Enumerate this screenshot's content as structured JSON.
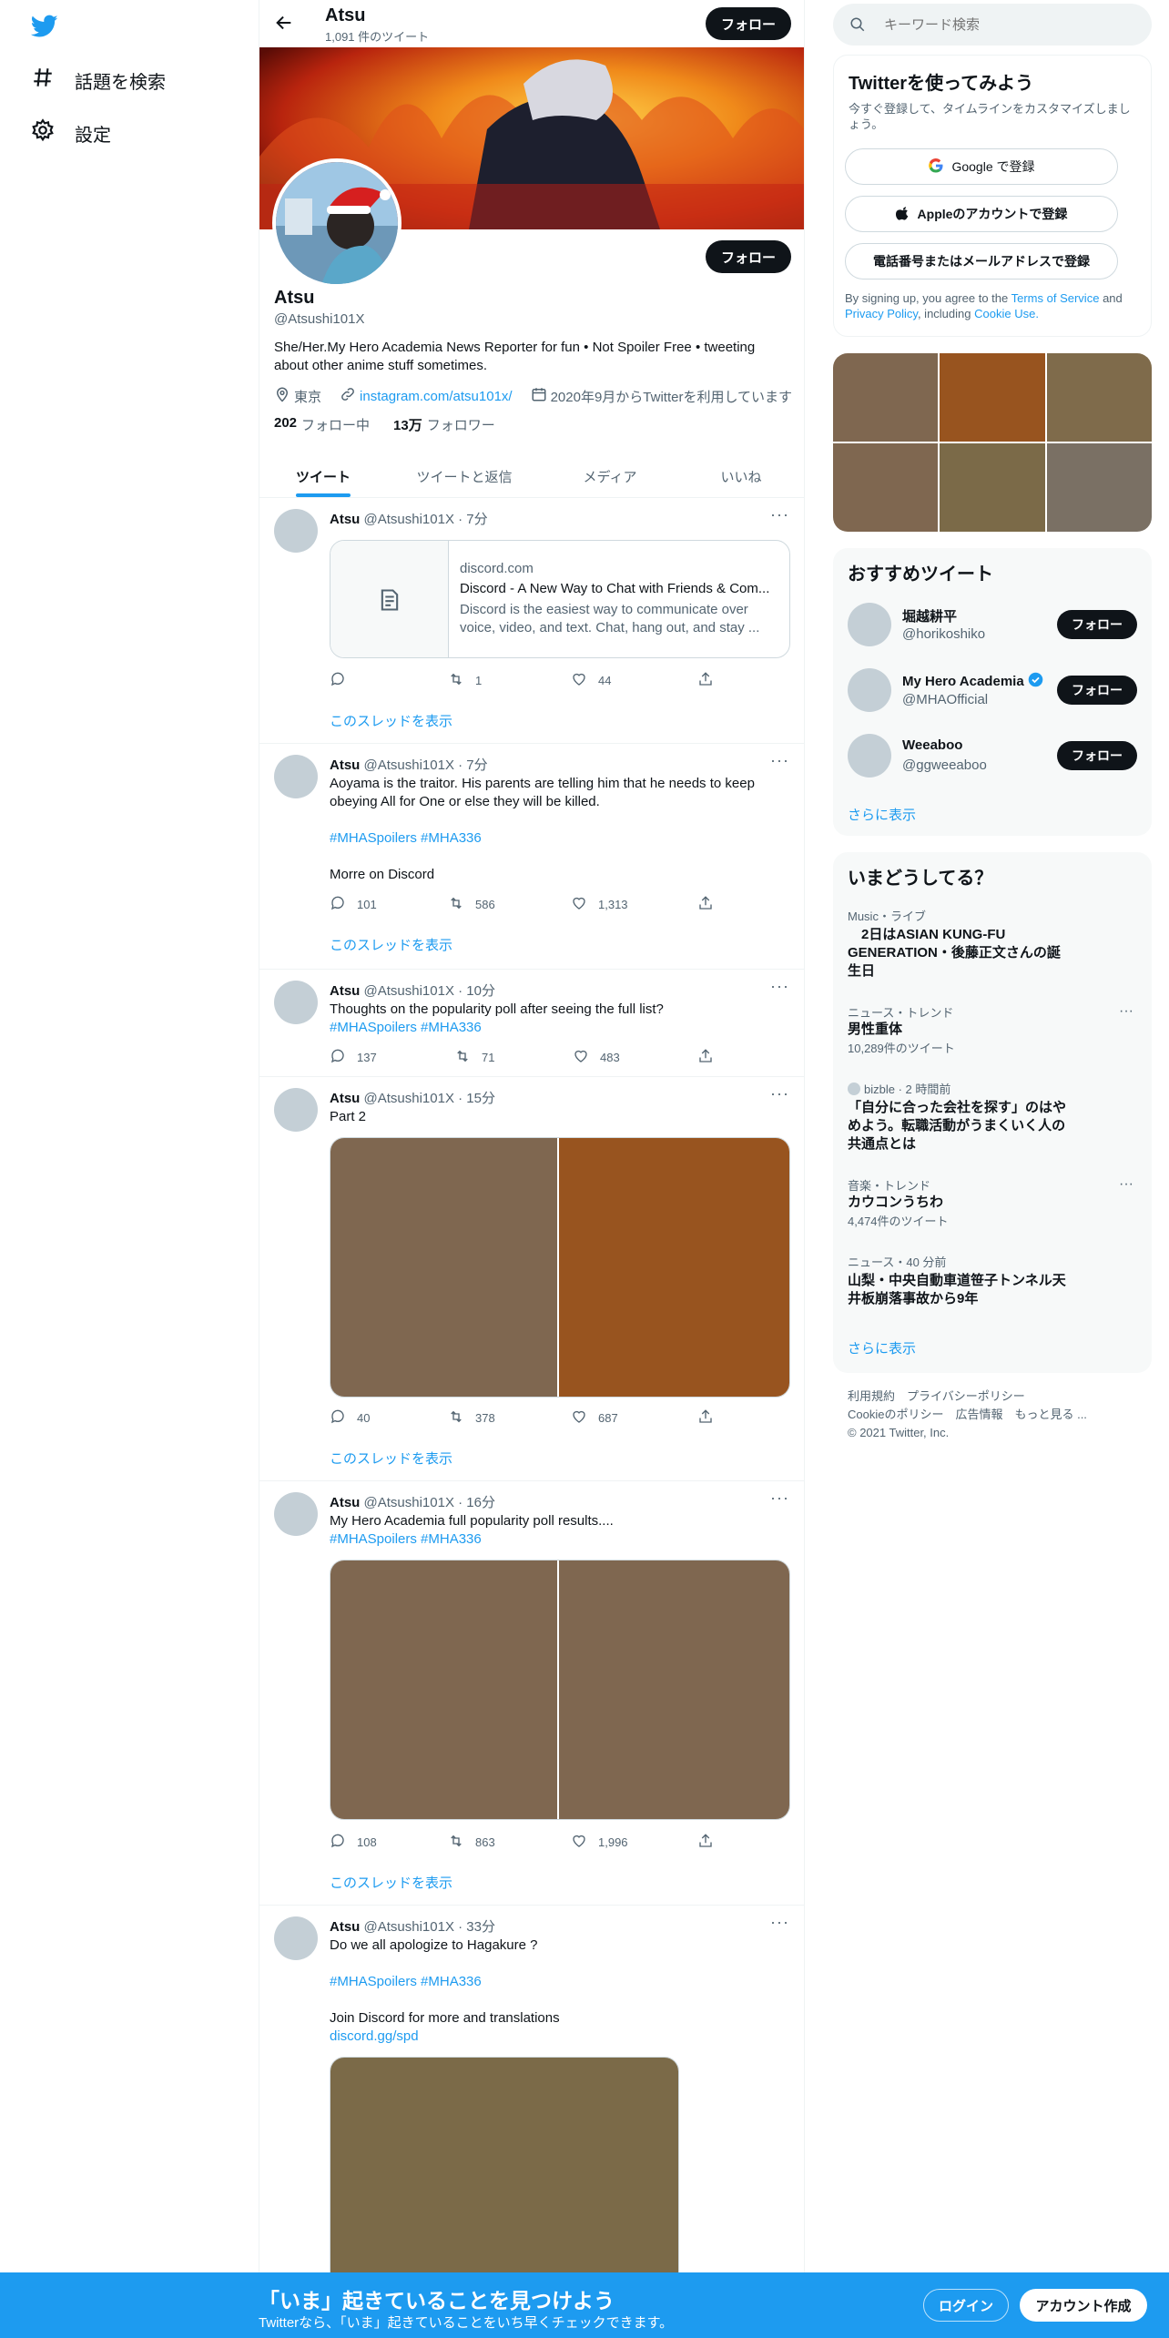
{
  "nav": {
    "explore_label": "話題を検索",
    "settings_label": "設定"
  },
  "header": {
    "name": "Atsu",
    "tweet_count": "1,091 件のツイート",
    "follow_label": "フォロー"
  },
  "profile": {
    "name": "Atsu",
    "handle": "@Atsushi101X",
    "bio": "She/Her.My Hero Academia News Reporter for fun • Not Spoiler Free • tweeting about other anime stuff sometimes.",
    "location": "東京",
    "website": "instagram.com/atsu101x/",
    "joined": "2020年9月からTwitterを利用しています",
    "following_count": "202",
    "following_label": "フォロー中",
    "followers_count": "13万",
    "followers_label": "フォロワー",
    "follow_label": "フォロー"
  },
  "tabs": [
    "ツイート",
    "ツイートと返信",
    "メディア",
    "いいね"
  ],
  "tweets": [
    {
      "name": "Atsu",
      "meta": "@Atsushi101X · 7分",
      "card_domain": "discord.com",
      "card_title": "Discord - A New Way to Chat with Friends & Com...",
      "card_desc": "Discord is the easiest way to communicate over voice, video, and text. Chat, hang out, and stay ...",
      "replies": "",
      "retweets": "1",
      "likes": "44",
      "thread": "このスレッドを表示"
    },
    {
      "name": "Atsu",
      "meta": "@Atsushi101X · 7分",
      "text": "Aoyama is the traitor. His parents are telling him that he needs to keep obeying All for One or else they will be killed.",
      "hashtags": "#MHASpoilers #MHA336",
      "extra": "Morre on Discord",
      "replies": "101",
      "retweets": "586",
      "likes": "1,313",
      "thread": "このスレッドを表示"
    },
    {
      "name": "Atsu",
      "meta": "@Atsushi101X · 10分",
      "text": "Thoughts on the popularity poll after seeing the full list?",
      "hashtags": "#MHASpoilers #MHA336",
      "replies": "137",
      "retweets": "71",
      "likes": "483"
    },
    {
      "name": "Atsu",
      "meta": "@Atsushi101X · 15分",
      "text": "Part 2",
      "replies": "40",
      "retweets": "378",
      "likes": "687",
      "thread": "このスレッドを表示",
      "media_colors": [
        "#7f6750",
        "#98541f"
      ]
    },
    {
      "name": "Atsu",
      "meta": "@Atsushi101X · 16分",
      "text": "My Hero Academia full popularity poll results....",
      "hashtags": "#MHASpoilers #MHA336",
      "replies": "108",
      "retweets": "863",
      "likes": "1,996",
      "thread": "このスレッドを表示",
      "media_colors": [
        "#7f6750",
        "#7f6750"
      ]
    },
    {
      "name": "Atsu",
      "meta": "@Atsushi101X · 33分",
      "text": "Do we all apologize to Hagakure ?",
      "hashtags": "#MHASpoilers #MHA336",
      "extra": "Join Discord for more and translations",
      "link": "discord.gg/spd",
      "media_colors": [
        "#7b6a48"
      ]
    }
  ],
  "search": {
    "placeholder": "キーワード検索"
  },
  "signup": {
    "title": "Twitterを使ってみよう",
    "subtitle": "今すぐ登録して、タイムラインをカスタマイズしましょう。",
    "google": "Google で登録",
    "apple": "Appleのアカウントで登録",
    "phone": "電話番号またはメールアドレスで登録",
    "terms_prefix": "By signing up, you agree to the",
    "terms": "Terms of Service",
    "and": "and",
    "privacy": "Privacy Policy",
    "including": ", including",
    "cookie": "Cookie Use."
  },
  "media_grid": [
    "#7f6750",
    "#98541f",
    "#7f6b4b",
    "#7f6750",
    "#7b6a48",
    "#7a7064"
  ],
  "recommended": {
    "title": "おすすめツイート",
    "users": [
      {
        "name": "堀越耕平",
        "handle": "@horikoshiko",
        "verified": false
      },
      {
        "name": "My Hero Academia",
        "handle": "@MHAOfficial",
        "verified": true
      },
      {
        "name": "Weeaboo",
        "handle": "@ggweeaboo",
        "verified": false
      }
    ],
    "follow_label": "フォロー",
    "more": "さらに表示"
  },
  "trends": {
    "title": "いまどうしてる？",
    "items": [
      {
        "category": "Music・ライブ",
        "title": "　2日はASIAN KUNG-FU GENERATION・後藤正文さんの誕生日"
      },
      {
        "category": "ニュース・トレンド",
        "title": "男性重体",
        "count": "10,289件のツイート"
      },
      {
        "category": "bizble · 2 時間前",
        "title": "「自分に合った会社を探す」のはやめよう。転職活動がうまくいく人の共通点とは"
      },
      {
        "category": "音楽・トレンド",
        "title": "カウコンうちわ",
        "count": "4,474件のツイート"
      },
      {
        "category": "ニュース・40 分前",
        "title": "山梨・中央自動車道笹子トンネル天井板崩落事故から9年"
      }
    ],
    "more": "さらに表示"
  },
  "footer": {
    "line1": "利用規約　プライバシーポリシー",
    "line2": "Cookieのポリシー　広告情報　もっと見る ...",
    "line3": "© 2021 Twitter, Inc."
  },
  "bottom": {
    "title": "「いま」起きていることを見つけよう",
    "subtitle": "Twitterなら、「いま」起きていることをいち早くチェックできます。",
    "login": "ログイン",
    "signup": "アカウント作成"
  }
}
